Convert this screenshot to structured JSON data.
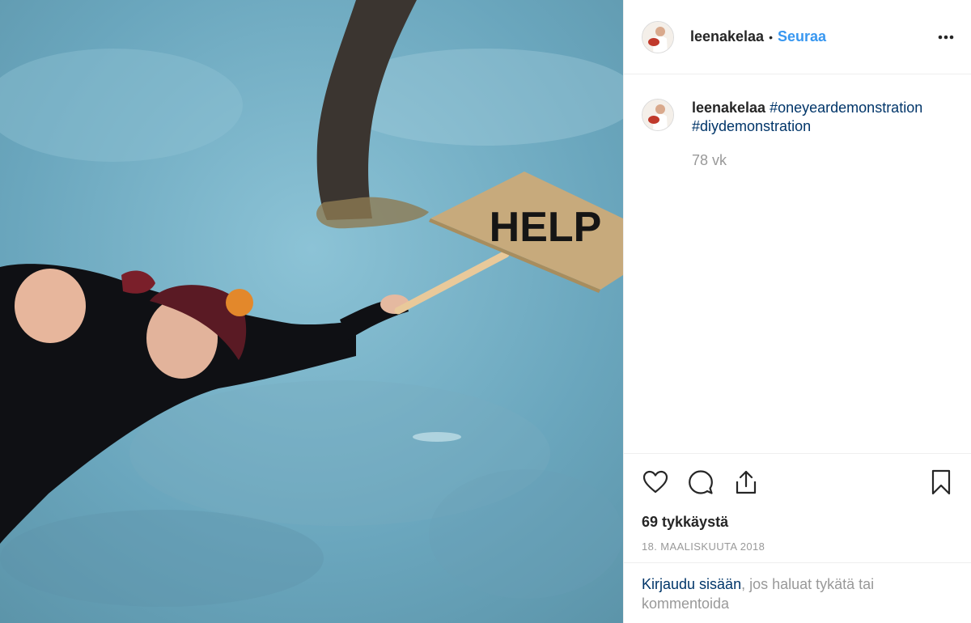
{
  "post": {
    "image_alt": "Woman lying on ice holding a HELP sign",
    "sign_text": "HELP",
    "header": {
      "username": "leenakelaa",
      "separator": "•",
      "follow_label": "Seuraa",
      "more_icon": "more-horizontal-icon"
    },
    "caption": {
      "username": "leenakelaa",
      "hashtag_1": "#oneyeardemonstration",
      "hashtag_2": "#diydemonstration",
      "time_ago": "78 vk"
    },
    "actions": {
      "like_icon": "heart-icon",
      "comment_icon": "comment-icon",
      "share_icon": "share-icon",
      "save_icon": "bookmark-icon"
    },
    "likes_text": "69 tykkäystä",
    "date_text": "18. maaliskuuta 2018",
    "login_prompt": {
      "link_text": "Kirjaudu sisään",
      "rest_text": ", jos haluat tykätä tai kommentoida"
    },
    "colors": {
      "link_blue": "#3897f0",
      "hashtag_navy": "#003569",
      "muted_gray": "#999999"
    }
  }
}
